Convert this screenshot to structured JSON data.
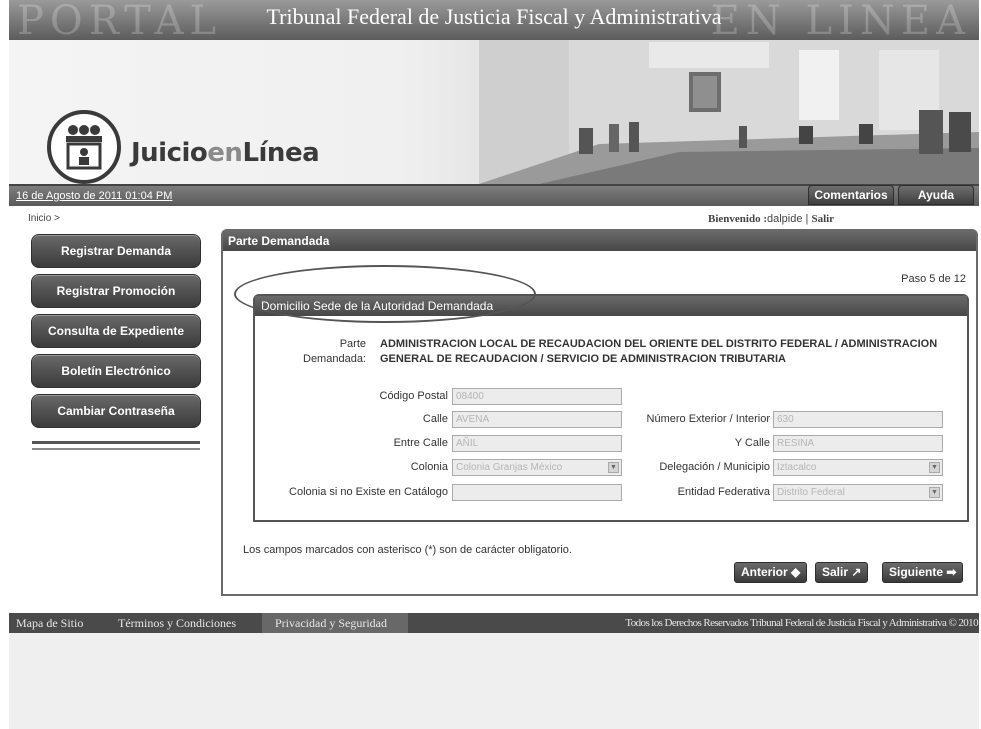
{
  "banner": {
    "title": "Tribunal Federal de Justicia Fiscal y Administrativa",
    "bg_left": "PORTAL",
    "bg_right": "EN LINEA"
  },
  "logo": {
    "text_main": "Juicio",
    "text_en": "en",
    "text_linea": "Línea"
  },
  "date": "16 de Agosto de 2011 01:04 PM",
  "top_buttons": {
    "comentarios": "Comentarios",
    "ayuda": "Ayuda"
  },
  "breadcrumb": "Inicio >",
  "welcome": {
    "prefix": "Bienvenido :",
    "user": "dalpide",
    "sep": " | ",
    "exit": "Salir"
  },
  "nav": [
    "Registrar Demanda",
    "Registrar Promoción",
    "Consulta de Expediente",
    "Boletín Electrónico",
    "Cambiar Contraseña"
  ],
  "main": {
    "title": "Parte Demandada",
    "step": "Paso 5 de 12",
    "section_title": "Domicilio Sede de la Autoridad Demandada",
    "parte_label_1": "Parte",
    "parte_label_2": "Demandada:",
    "parte_value": "ADMINISTRACION LOCAL DE RECAUDACION DEL ORIENTE DEL DISTRITO FEDERAL / ADMINISTRACION GENERAL DE RECAUDACION / SERVICIO DE ADMINISTRACION TRIBUTARIA",
    "fields": {
      "codigo_postal": {
        "label": "Código Postal",
        "value": "08400"
      },
      "calle": {
        "label": "Calle",
        "value": "AVENA"
      },
      "numero": {
        "label": "Número Exterior / Interior",
        "value": "630"
      },
      "entre_calle": {
        "label": "Entre Calle",
        "value": "AÑIL"
      },
      "y_calle": {
        "label": "Y Calle",
        "value": "RESINA"
      },
      "colonia": {
        "label": "Colonia",
        "value": "Colonia Granjas México"
      },
      "delegacion": {
        "label": "Delegación / Municipio",
        "value": "Iztacalco"
      },
      "colonia_no_existe": {
        "label": "Colonia si no Existe en Catálogo",
        "value": ""
      },
      "entidad": {
        "label": "Entidad Federativa",
        "value": "Distrito Federal"
      }
    },
    "note": "Los campos marcados con asterisco (*) son de carácter obligatorio.",
    "buttons": {
      "anterior": "Anterior",
      "salir": "Salir",
      "siguiente": "Siguiente"
    }
  },
  "footer": {
    "mapa": "Mapa de Sitio",
    "terminos": "Términos y Condiciones",
    "privacidad": "Privacidad y Seguridad",
    "copyright": "Todos los Derechos Reservados  Tribunal Federal de Justicia Fiscal y Administrativa  © 2010"
  }
}
